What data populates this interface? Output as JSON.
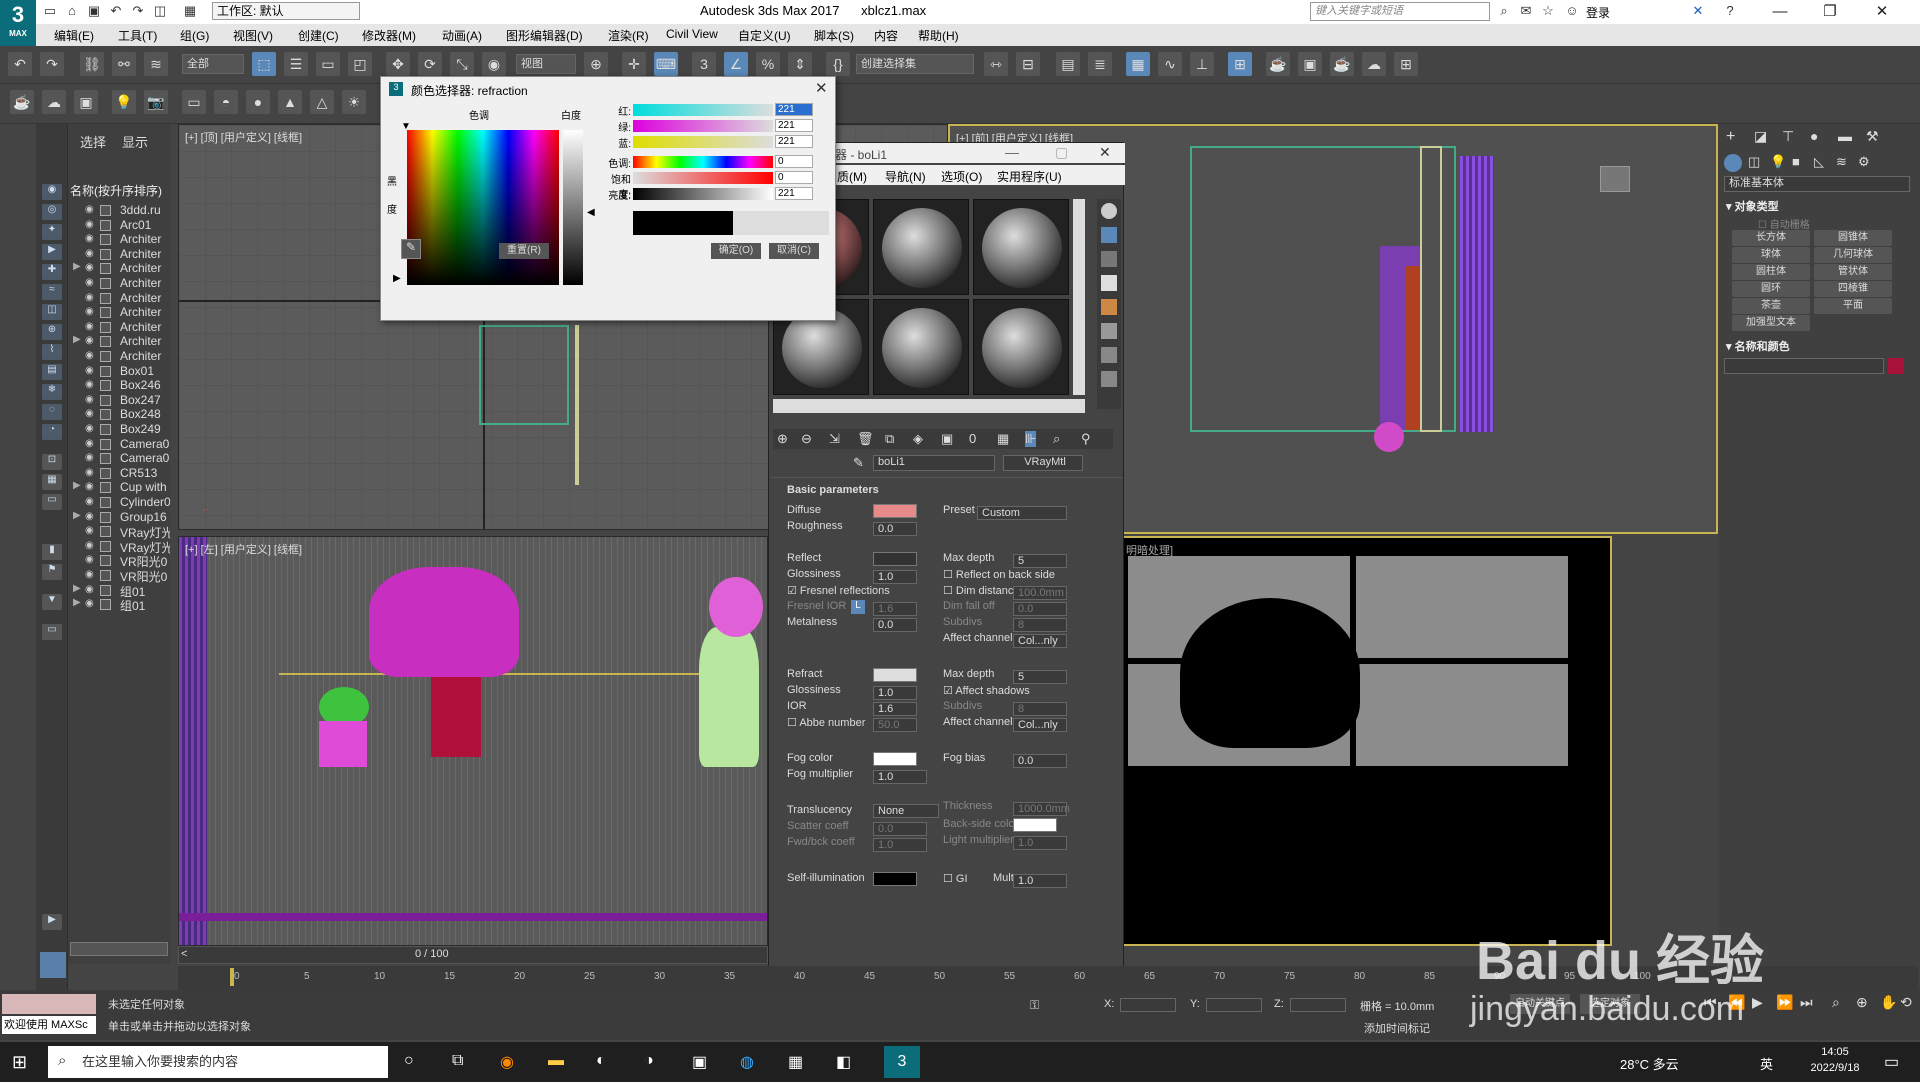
{
  "titlebar": {
    "logo_text": "3",
    "logo_sub": "MAX",
    "workspace": "工作区: 默认",
    "app_title": "Autodesk 3ds Max 2017",
    "file_name": "xblcz1.max",
    "search_placeholder": "键入关键字或短语",
    "login": "登录"
  },
  "menubar": [
    "编辑(E)",
    "工具(T)",
    "组(G)",
    "视图(V)",
    "创建(C)",
    "修改器(M)",
    "动画(A)",
    "图形编辑器(D)",
    "渲染(R)",
    "Civil View",
    "自定义(U)",
    "脚本(S)",
    "内容",
    "帮助(H)"
  ],
  "toolbar": {
    "filter_dropdown": "全部",
    "view_dropdown": "视图",
    "selection_set": "创建选择集"
  },
  "scene_explorer": {
    "tab_select": "选择",
    "tab_display": "显示",
    "header": "名称(按升序排序)",
    "items": [
      {
        "name": "3ddd.ru",
        "expand": ""
      },
      {
        "name": "Arc01",
        "expand": ""
      },
      {
        "name": "Architer",
        "expand": ""
      },
      {
        "name": "Architer",
        "expand": ""
      },
      {
        "name": "Architer",
        "expand": "▶"
      },
      {
        "name": "Architer",
        "expand": ""
      },
      {
        "name": "Architer",
        "expand": ""
      },
      {
        "name": "Architer",
        "expand": ""
      },
      {
        "name": "Architer",
        "expand": ""
      },
      {
        "name": "Architer",
        "expand": "▶"
      },
      {
        "name": "Architer",
        "expand": ""
      },
      {
        "name": "Box01",
        "expand": ""
      },
      {
        "name": "Box246",
        "expand": ""
      },
      {
        "name": "Box247",
        "expand": ""
      },
      {
        "name": "Box248",
        "expand": ""
      },
      {
        "name": "Box249",
        "expand": ""
      },
      {
        "name": "Camera0",
        "expand": ""
      },
      {
        "name": "Camera0",
        "expand": ""
      },
      {
        "name": "CR513",
        "expand": ""
      },
      {
        "name": "Cup with",
        "expand": "▶"
      },
      {
        "name": "Cylinder0",
        "expand": ""
      },
      {
        "name": "Group16",
        "expand": "▶"
      },
      {
        "name": "VRay灯光",
        "expand": ""
      },
      {
        "name": "VRay灯光",
        "expand": ""
      },
      {
        "name": "VR阳光0",
        "expand": ""
      },
      {
        "name": "VR阳光0",
        "expand": ""
      },
      {
        "name": "组01",
        "expand": "▶"
      },
      {
        "name": "组01",
        "expand": "▶"
      }
    ]
  },
  "viewports": {
    "top_label": "[+] [顶] [用户定义] [线框]",
    "front_label": "[+] [前] [用户定义] [线框]",
    "left_label": "[+] [左] [用户定义] [线框]",
    "persp_label": "明暗处理]"
  },
  "color_picker": {
    "title": "颜色选择器: refraction",
    "hue_label": "色调",
    "white_label": "白度",
    "black_label": "黑",
    "degree_label": "度",
    "rows": [
      {
        "label": "红:",
        "value": "221"
      },
      {
        "label": "绿:",
        "value": "221"
      },
      {
        "label": "蓝:",
        "value": "221"
      },
      {
        "label": "色调:",
        "value": "0"
      },
      {
        "label": "饱和度:",
        "value": "0"
      },
      {
        "label": "亮度:",
        "value": "221"
      }
    ],
    "reset": "重置(R)",
    "ok": "确定(O)",
    "cancel": "取消(C)"
  },
  "material_editor": {
    "title": "器 - boLi1",
    "menu": [
      "质(M)",
      "导航(N)",
      "选项(O)",
      "实用程序(U)"
    ],
    "material_name": "boLi1",
    "material_type": "VRayMtl",
    "rollout": "Basic parameters",
    "diffuse": "Diffuse",
    "preset_label": "Preset",
    "preset_value": "Custom",
    "roughness": {
      "label": "Roughness",
      "value": "0.0"
    },
    "reflect": "Reflect",
    "refl_max_depth": {
      "label": "Max depth",
      "value": "5"
    },
    "refl_gloss": {
      "label": "Glossiness",
      "value": "1.0"
    },
    "reflect_back": "Reflect on back side",
    "fresnel": "Fresnel reflections",
    "dim_distance": {
      "label": "Dim distance",
      "value": "100.0mm"
    },
    "fresnel_ior": {
      "label": "Fresnel IOR",
      "value": "1.6",
      "lock": "L"
    },
    "dim_falloff": {
      "label": "Dim fall off",
      "value": "0.0"
    },
    "refl_subdivs": {
      "label": "Subdivs",
      "value": "8"
    },
    "metalness": {
      "label": "Metalness",
      "value": "0.0"
    },
    "affect_channels": {
      "label": "Affect channels",
      "value": "Col...nly"
    },
    "refract": "Refract",
    "refr_max_depth": {
      "label": "Max depth",
      "value": "5"
    },
    "refr_gloss": {
      "label": "Glossiness",
      "value": "1.0"
    },
    "affect_shadows": "Affect shadows",
    "ior": {
      "label": "IOR",
      "value": "1.6"
    },
    "refr_subdivs": {
      "label": "Subdivs",
      "value": "8"
    },
    "abbe": {
      "label": "Abbe number",
      "value": "50.0"
    },
    "refr_affect": {
      "label": "Affect channels",
      "value": "Col...nly"
    },
    "fog_color": "Fog color",
    "fog_bias": {
      "label": "Fog bias",
      "value": "0.0"
    },
    "fog_mult": {
      "label": "Fog multiplier",
      "value": "1.0"
    },
    "translucency": {
      "label": "Translucency",
      "value": "None"
    },
    "thickness": {
      "label": "Thickness",
      "value": "1000.0mm"
    },
    "scatter": {
      "label": "Scatter coeff",
      "value": "0.0"
    },
    "backside_color": "Back-side color",
    "fwd_bck": {
      "label": "Fwd/bck coeff",
      "value": "1.0"
    },
    "light_mult": {
      "label": "Light multiplier",
      "value": "1.0"
    },
    "self_illum": "Self-illumination",
    "gi": "GI",
    "mult": {
      "label": "Mult",
      "value": "1.0"
    }
  },
  "command_panel": {
    "dropdown": "标准基本体",
    "object_type": "对象类型",
    "autogrid": "自动栅格",
    "buttons": [
      "长方体",
      "圆锥体",
      "球体",
      "几何球体",
      "圆柱体",
      "管状体",
      "圆环",
      "四棱锥",
      "茶壶",
      "平面",
      "加强型文本"
    ],
    "name_color": "名称和颜色"
  },
  "timeline": {
    "frame": "0 / 100",
    "ticks": [
      "0",
      "5",
      "10",
      "15",
      "20",
      "25",
      "30",
      "35",
      "40",
      "45",
      "50",
      "55",
      "60",
      "65",
      "70",
      "75",
      "80",
      "85",
      "90",
      "95",
      "100"
    ]
  },
  "statusbar": {
    "welcome": "欢迎使用 MAXSc",
    "line1": "未选定任何对象",
    "line2": "单击或单击并拖动以选择对象",
    "x": "X:",
    "y": "Y:",
    "z": "Z:",
    "grid": "栅格 = 10.0mm",
    "auto_key": "自动关键点",
    "sel_obj": "选定对象",
    "add_tag": "添加时间标记"
  },
  "taskbar": {
    "search": "在这里输入你要搜索的内容",
    "weather": "28°C 多云",
    "ime": "英",
    "time": "14:05",
    "date": "2022/9/18"
  },
  "watermark": {
    "text": "Bai du 经验",
    "url": "jingyan.baidu.com"
  }
}
